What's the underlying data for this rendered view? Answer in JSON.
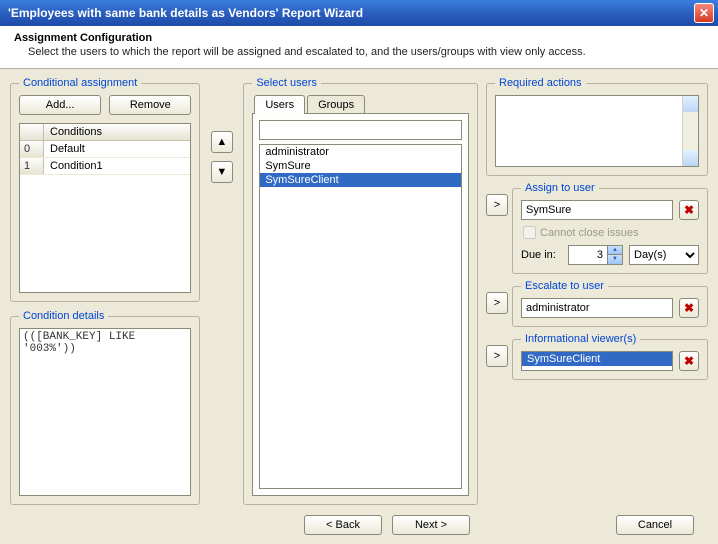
{
  "window": {
    "title": "'Employees with same bank details as Vendors' Report Wizard"
  },
  "header": {
    "title": "Assignment Configuration",
    "description": "Select the users to which the report will be assigned and escalated to, and the users/groups with view only access."
  },
  "conditional": {
    "legend": "Conditional assignment",
    "add_label": "Add...",
    "remove_label": "Remove",
    "col_header": "Conditions",
    "rows": [
      {
        "idx": "0",
        "name": "Default"
      },
      {
        "idx": "1",
        "name": "Condition1"
      }
    ]
  },
  "condition_details": {
    "legend": "Condition details",
    "expression": "(([BANK_KEY] LIKE '003%'))"
  },
  "select_users": {
    "legend": "Select users",
    "tabs": {
      "users": "Users",
      "groups": "Groups"
    },
    "items": [
      {
        "name": "administrator",
        "selected": false
      },
      {
        "name": "SymSure",
        "selected": false
      },
      {
        "name": "SymSureClient",
        "selected": true
      }
    ]
  },
  "required_actions": {
    "legend": "Required actions",
    "value": ""
  },
  "assign": {
    "legend": "Assign to user",
    "value": "SymSure",
    "cannot_close_label": "Cannot close issues",
    "due_label": "Due in:",
    "due_value": "3",
    "due_unit": "Day(s)"
  },
  "escalate": {
    "legend": "Escalate to user",
    "value": "administrator"
  },
  "viewers": {
    "legend": "Informational viewer(s)",
    "items": [
      {
        "name": "SymSureClient",
        "selected": true
      }
    ]
  },
  "footer": {
    "back": "< Back",
    "next": "Next >",
    "cancel": "Cancel"
  },
  "arrow_right": ">"
}
